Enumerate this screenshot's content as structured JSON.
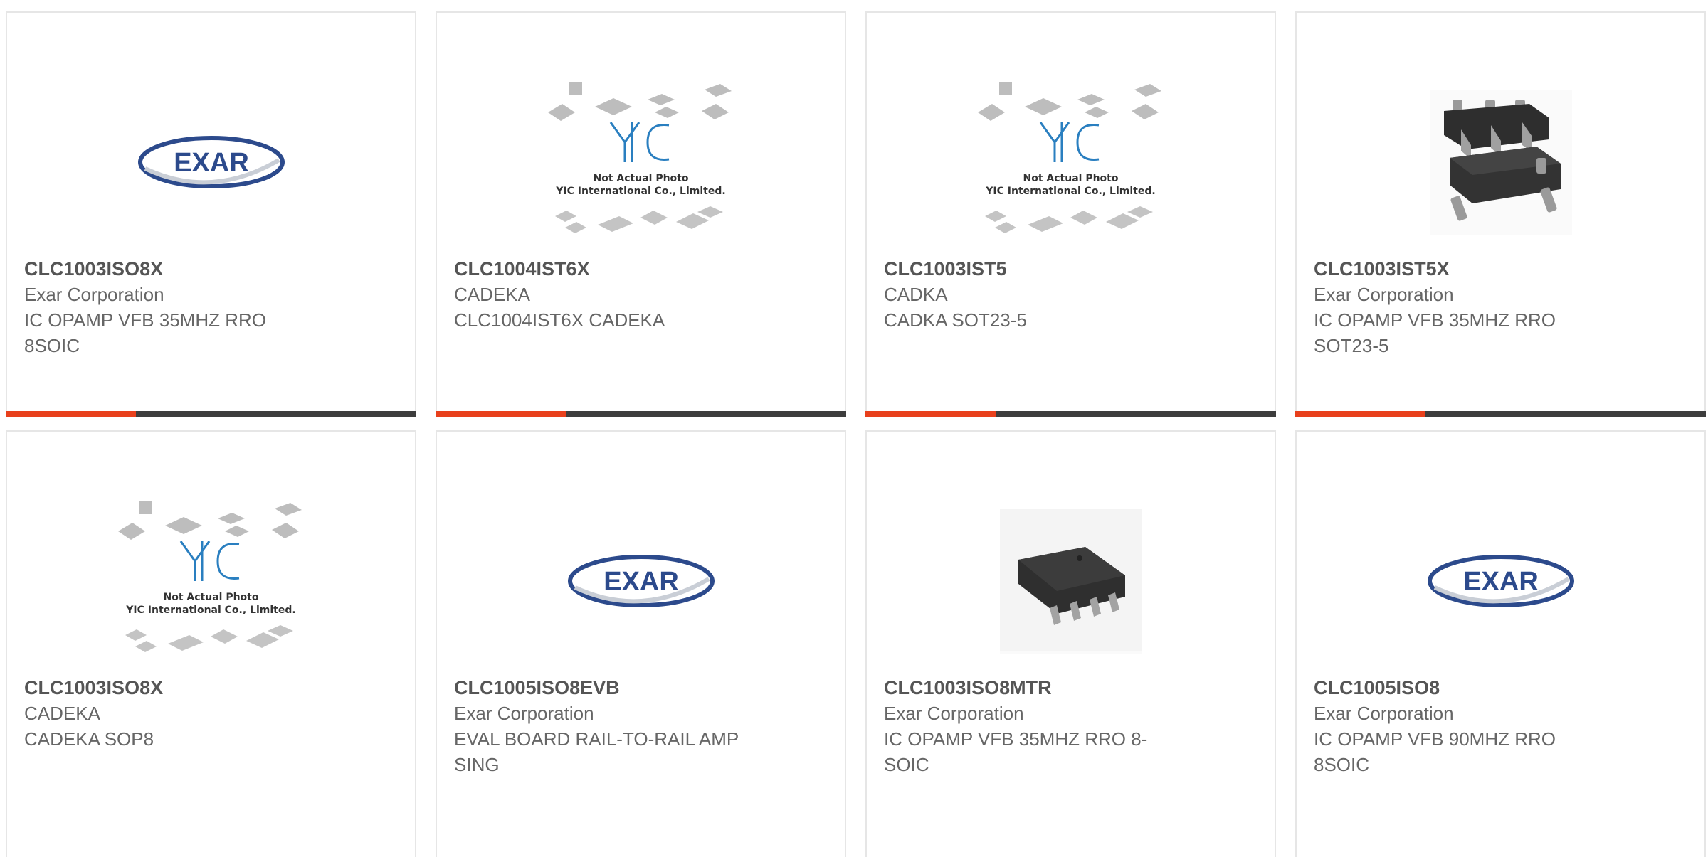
{
  "products": [
    {
      "part_number": "CLC1003ISO8X",
      "manufacturer": "Exar Corporation",
      "description": "IC OPAMP VFB 35MHZ RRO 8SOIC",
      "image": "exar-logo"
    },
    {
      "part_number": "CLC1004IST6X",
      "manufacturer": "CADEKA",
      "description": "CLC1004IST6X CADEKA",
      "image": "yic-placeholder",
      "image_caption_line1": "Not Actual Photo",
      "image_caption_line2": "YIC International Co., Limited."
    },
    {
      "part_number": "CLC1003IST5",
      "manufacturer": "CADKA",
      "description": "CADKA SOT23-5",
      "image": "yic-placeholder",
      "image_caption_line1": "Not Actual Photo",
      "image_caption_line2": "YIC International Co., Limited."
    },
    {
      "part_number": "CLC1003IST5X",
      "manufacturer": "Exar Corporation",
      "description": "IC OPAMP VFB 35MHZ RRO SOT23-5",
      "image": "sot23-chip-photo"
    },
    {
      "part_number": "CLC1003ISO8X",
      "manufacturer": "CADEKA",
      "description": "CADEKA SOP8",
      "image": "yic-placeholder",
      "image_caption_line1": "Not Actual Photo",
      "image_caption_line2": "YIC International Co., Limited."
    },
    {
      "part_number": "CLC1005ISO8EVB",
      "manufacturer": "Exar Corporation",
      "description": "EVAL BOARD RAIL-TO-RAIL AMP SING",
      "image": "exar-logo"
    },
    {
      "part_number": "CLC1003ISO8MTR",
      "manufacturer": "Exar Corporation",
      "description": "IC OPAMP VFB 35MHZ RRO 8-SOIC",
      "image": "soic8-chip-photo"
    },
    {
      "part_number": "CLC1005ISO8",
      "manufacturer": "Exar Corporation",
      "description": "IC OPAMP VFB 90MHZ RRO 8SOIC",
      "image": "exar-logo"
    }
  ],
  "logos": {
    "exar_text": "EXAR",
    "yic_text": "YIC"
  },
  "colors": {
    "accent": "#e8401c",
    "bar": "#3d3d3d",
    "exar_blue": "#2c4a8c",
    "yic_blue": "#2a7fc0"
  }
}
